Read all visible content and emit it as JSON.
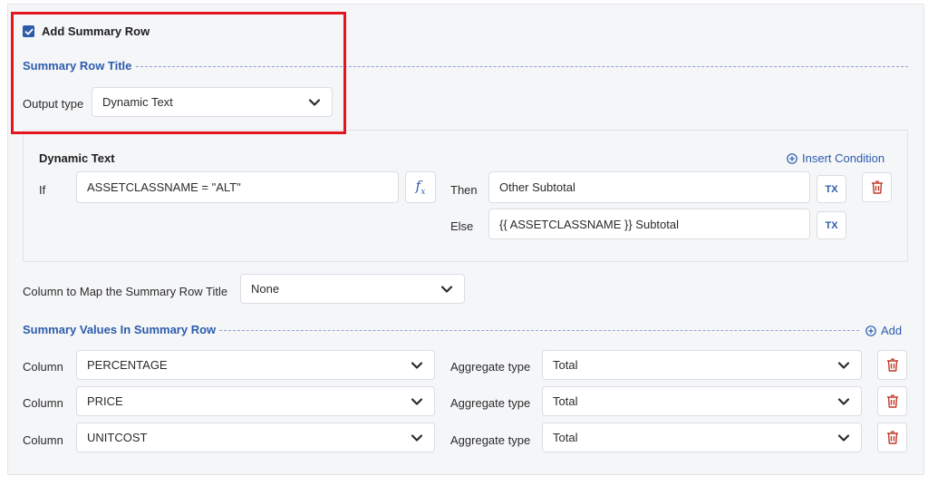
{
  "summary_checkbox": {
    "label": "Add Summary Row",
    "checked": true
  },
  "title_section": {
    "heading": "Summary Row Title",
    "output_type_label": "Output type",
    "output_type_value": "Dynamic Text"
  },
  "dynamic_text": {
    "heading": "Dynamic Text",
    "insert_condition_label": "Insert Condition",
    "if_label": "If",
    "condition_value": "ASSETCLASSNAME = \"ALT\"",
    "then_label": "Then",
    "then_value": "Other Subtotal",
    "else_label": "Else",
    "else_value": "{{ ASSETCLASSNAME }} Subtotal",
    "tx_label": "TX",
    "fx_label": "fx"
  },
  "column_map": {
    "label": "Column to Map the Summary Row Title",
    "value": "None"
  },
  "summary_values": {
    "heading": "Summary Values In Summary Row",
    "add_label": "Add",
    "rows": [
      {
        "column_label": "Column",
        "column_value": "PERCENTAGE",
        "aggregate_label": "Aggregate type",
        "aggregate_value": "Total"
      },
      {
        "column_label": "Column",
        "column_value": "PRICE",
        "aggregate_label": "Aggregate type",
        "aggregate_value": "Total"
      },
      {
        "column_label": "Column",
        "column_value": "UNITCOST",
        "aggregate_label": "Aggregate type",
        "aggregate_value": "Total"
      }
    ]
  },
  "colors": {
    "accent": "#2c5cad",
    "highlight": "#e3161f",
    "delete": "#c0392b"
  },
  "icons": [
    "checkbox-checked-icon",
    "chevron-down-icon",
    "fx-icon",
    "tx-icon",
    "trash-icon",
    "plus-circle-icon"
  ]
}
